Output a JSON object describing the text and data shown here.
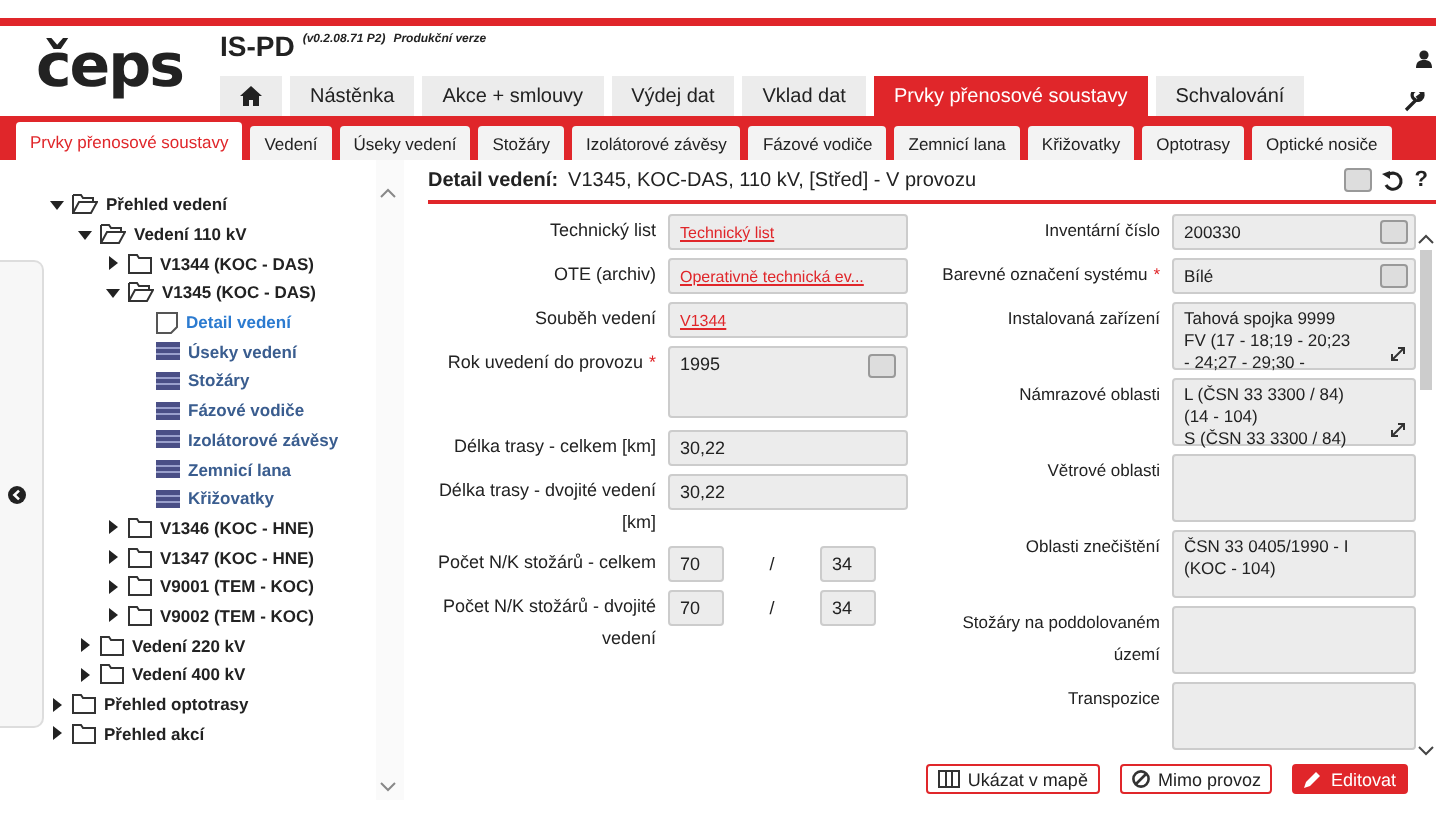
{
  "header": {
    "logo": "čeps",
    "app_title": "IS-PD",
    "version": "(v0.2.08.71 P2)",
    "environment": "Produkční verze"
  },
  "main_tabs": [
    {
      "kind": "home",
      "selected": false
    },
    {
      "kind": "text",
      "label": "Nástěnka",
      "selected": false
    },
    {
      "kind": "text",
      "label": "Akce + smlouvy",
      "selected": false
    },
    {
      "kind": "text",
      "label": "Výdej dat",
      "selected": false
    },
    {
      "kind": "text",
      "label": "Vklad dat",
      "selected": false
    },
    {
      "kind": "text",
      "label": "Prvky přenosové soustavy",
      "selected": true
    },
    {
      "kind": "text",
      "label": "Schvalování",
      "selected": false
    }
  ],
  "sub_tabs": [
    {
      "label": "Prvky přenosové soustavy",
      "selected": true
    },
    {
      "label": "Vedení",
      "selected": false
    },
    {
      "label": "Úseky vedení",
      "selected": false
    },
    {
      "label": "Stožáry",
      "selected": false
    },
    {
      "label": "Izolátorové závěsy",
      "selected": false
    },
    {
      "label": "Fázové vodiče",
      "selected": false
    },
    {
      "label": "Zemnicí lana",
      "selected": false
    },
    {
      "label": "Křižovatky",
      "selected": false
    },
    {
      "label": "Optotrasy",
      "selected": false
    },
    {
      "label": "Optické nosiče",
      "selected": false
    }
  ],
  "tree": [
    {
      "label": "Přehled vedení",
      "kind": "folder",
      "expanded": true,
      "children": [
        {
          "label": "Vedení 110 kV",
          "kind": "folder",
          "expanded": true,
          "children": [
            {
              "label": "V1344 (KOC - DAS)",
              "kind": "folder",
              "expanded": false
            },
            {
              "label": "V1345 (KOC - DAS)",
              "kind": "folder",
              "expanded": true,
              "children": [
                {
                  "label": "Detail vedení",
                  "kind": "page",
                  "selected": true
                },
                {
                  "label": "Úseky vedení",
                  "kind": "table",
                  "selected": false
                },
                {
                  "label": "Stožáry",
                  "kind": "table",
                  "selected": false
                },
                {
                  "label": "Fázové vodiče",
                  "kind": "table",
                  "selected": false
                },
                {
                  "label": "Izolátorové závěsy",
                  "kind": "table",
                  "selected": false
                },
                {
                  "label": "Zemnicí lana",
                  "kind": "table",
                  "selected": false
                },
                {
                  "label": "Křižovatky",
                  "kind": "table",
                  "selected": false
                }
              ]
            },
            {
              "label": "V1346 (KOC - HNE)",
              "kind": "folder",
              "expanded": false
            },
            {
              "label": "V1347 (KOC - HNE)",
              "kind": "folder",
              "expanded": false
            },
            {
              "label": "V9001 (TEM - KOC)",
              "kind": "folder",
              "expanded": false
            },
            {
              "label": "V9002 (TEM - KOC)",
              "kind": "folder",
              "expanded": false
            }
          ]
        },
        {
          "label": "Vedení 220 kV",
          "kind": "folder",
          "expanded": false
        },
        {
          "label": "Vedení 400 kV",
          "kind": "folder",
          "expanded": false
        }
      ]
    },
    {
      "label": "Přehled optotrasy",
      "kind": "folder",
      "expanded": false
    },
    {
      "label": "Přehled akcí",
      "kind": "folder",
      "expanded": false
    }
  ],
  "detail": {
    "title": "Detail vedení:",
    "subtitle": "V1345, KOC-DAS, 110 kV, [Střed] - V provozu",
    "fields_left": [
      {
        "label": "Technický list",
        "kind": "link",
        "value": "Technický list"
      },
      {
        "label": "OTE (archiv)",
        "kind": "link",
        "value": "Operativně technická ev..."
      },
      {
        "label": "Souběh vedení",
        "kind": "link",
        "value": "V1344"
      },
      {
        "label": "Rok uvedení do provozu",
        "required_mark": "*",
        "kind": "tall",
        "value": "1995"
      },
      {
        "label": "Délka trasy - celkem [km]",
        "kind": "text",
        "value": "30,22"
      },
      {
        "label": "Délka trasy - dvojité vedení [km]",
        "kind": "text",
        "value": "30,22"
      },
      {
        "label": "Počet N/K stožárů - celkem",
        "kind": "pair",
        "value": "70",
        "separator": "/",
        "value_2": "34"
      },
      {
        "label": "Počet N/K stožárů - dvojité vedení",
        "kind": "pair",
        "value": "70",
        "separator": "/",
        "value_2": "34"
      }
    ],
    "fields_right": [
      {
        "label": "Inventární číslo",
        "kind": "select",
        "value": "200330"
      },
      {
        "label": "Barevné označení systému",
        "required_mark": "*",
        "kind": "select",
        "value": "Bílé"
      },
      {
        "label": "Instalovaná zařízení",
        "kind": "area",
        "value": "Tahová spojka 9999\nFV (17 - 18;19 - 20;23\n- 24;27 - 29;30 -"
      },
      {
        "label": "Námrazové oblasti",
        "kind": "area",
        "value": "L (ČSN 33 3300 / 84)\n(14 - 104)\nS (ČSN 33 3300 / 84)"
      },
      {
        "label": "Větrové oblasti",
        "kind": "box"
      },
      {
        "label": "Oblasti znečištění",
        "kind": "box",
        "value": "ČSN 33 0405/1990 - I\n(KOC - 104)"
      },
      {
        "label": "Stožáry na poddolovaném území",
        "kind": "box"
      },
      {
        "label": "Transpozice",
        "kind": "box"
      }
    ]
  },
  "header_checkbox": {
    "checked": false
  },
  "help_label": "?",
  "buttons": [
    {
      "label": "Ukázat v mapě",
      "kind": "map"
    },
    {
      "label": "Mimo provoz",
      "kind": "block"
    },
    {
      "label": "Editovat",
      "kind": "edit"
    }
  ]
}
